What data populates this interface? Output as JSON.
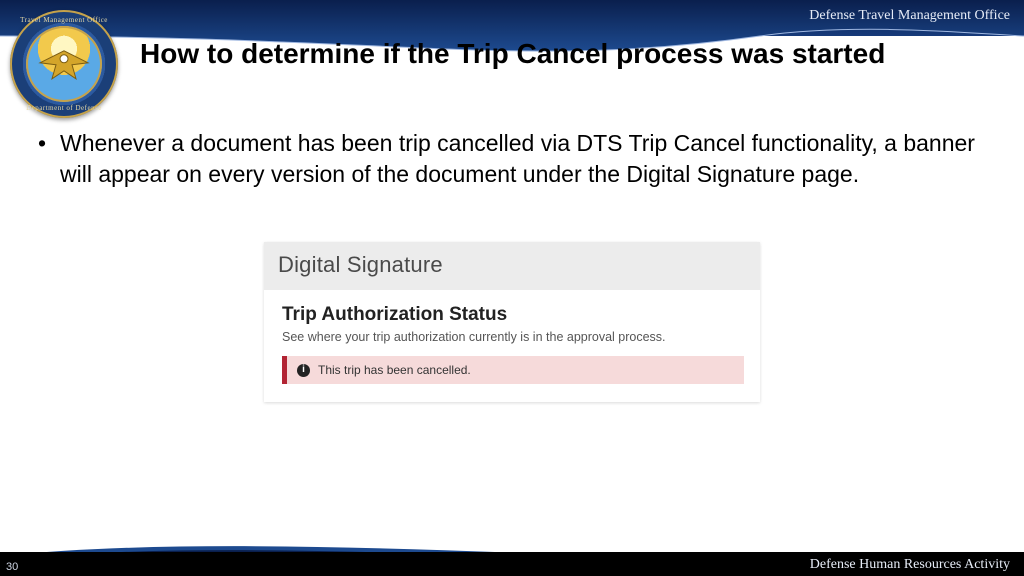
{
  "header": {
    "org_right": "Defense Travel Management Office",
    "seal_top": "Travel Management Office",
    "seal_bottom": "Department of Defense"
  },
  "title": "How to determine if the Trip Cancel process was started",
  "bullet": "Whenever a document has been trip cancelled via DTS Trip Cancel functionality, a banner will appear on every version of the document under the Digital Signature page.",
  "screenshot": {
    "section_header": "Digital Signature",
    "status_title": "Trip Authorization Status",
    "status_sub": "See where your trip authorization currently is in the approval process.",
    "alert_icon_glyph": "i",
    "alert_text": "This trip has been cancelled."
  },
  "footer": {
    "page_number": "30",
    "org_right": "Defense Human Resources Activity"
  }
}
